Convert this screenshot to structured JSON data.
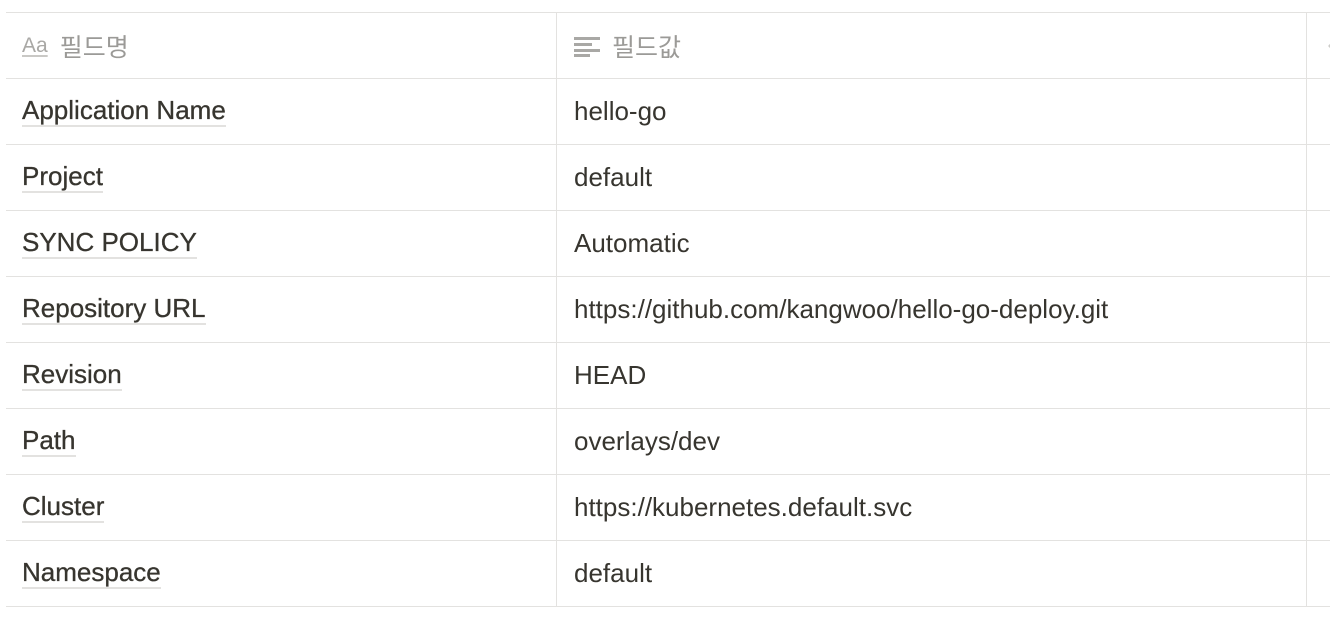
{
  "table": {
    "headers": {
      "name_icon": "Aa",
      "name_label": "필드명",
      "value_icon": "text-lines-icon",
      "value_label": "필드값"
    },
    "rows": [
      {
        "name": "Application Name",
        "value": "hello-go"
      },
      {
        "name": "Project",
        "value": "default"
      },
      {
        "name": "SYNC POLICY",
        "value": "Automatic"
      },
      {
        "name": "Repository URL",
        "value": "https://github.com/kangwoo/hello-go-deploy.git"
      },
      {
        "name": "Revision",
        "value": "HEAD"
      },
      {
        "name": "Path",
        "value": "overlays/dev"
      },
      {
        "name": "Cluster",
        "value": "https://kubernetes.default.svc"
      },
      {
        "name": "Namespace",
        "value": "default"
      }
    ]
  },
  "colors": {
    "text": "#37352f",
    "muted": "#9b9a97",
    "border": "#e3e2e0"
  }
}
